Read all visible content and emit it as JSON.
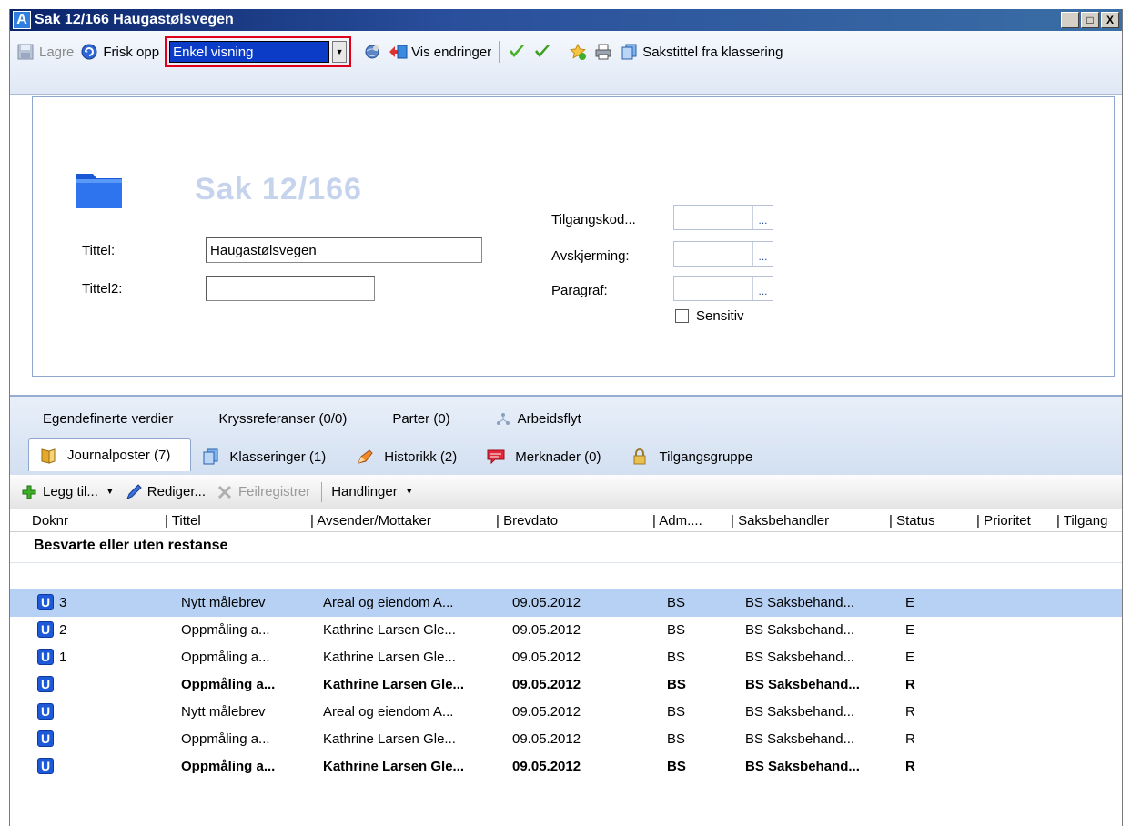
{
  "window": {
    "title": "Sak 12/166 Haugastølsvegen",
    "app_icon_letter": "A",
    "controls": [
      "_",
      "□",
      "X"
    ]
  },
  "toolbar": {
    "save_label": "Lagre",
    "refresh_label": "Frisk opp",
    "view_mode_value": "Enkel visning",
    "show_changes_label": "Vis endringer",
    "title_from_class_label": "Sakstittel fra klassering"
  },
  "case": {
    "heading": "Sak 12/166",
    "title_label": "Tittel:",
    "title_value": "Haugastølsvegen",
    "title2_label": "Tittel2:",
    "title2_value": "",
    "access_code_label": "Tilgangskod...",
    "screening_label": "Avskjerming:",
    "paragraph_label": "Paragraf:",
    "lookup_button": "...",
    "sensitive_label": "Sensitiv"
  },
  "tabs_row1": [
    "Egendefinerte verdier",
    "Kryssreferanser (0/0)",
    "Parter (0)",
    "Arbeidsflyt"
  ],
  "tabs_row2": [
    "Journalposter (7)",
    "Klasseringer (1)",
    "Historikk (2)",
    "Merknader (0)",
    "Tilgangsgruppe"
  ],
  "grid_toolbar": {
    "add_label": "Legg til...",
    "edit_label": "Rediger...",
    "misregister_label": "Feilregistrer",
    "actions_label": "Handlinger"
  },
  "columns": [
    "Doknr",
    "| Tittel",
    "| Avsender/Mottaker",
    "| Brevdato",
    "| Adm....",
    "| Saksbehandler",
    "| Status",
    "| Prioritet",
    "| Tilgang"
  ],
  "group_label": "Besvarte eller uten restanse",
  "rows": [
    {
      "doknr": "3",
      "tittel": "Nytt målebrev",
      "avsender": "Areal og eiendom A...",
      "brevdato": "09.05.2012",
      "adm": "BS",
      "saksbehandler": "BS Saksbehand...",
      "status": "E"
    },
    {
      "doknr": "2",
      "tittel": "Oppmåling a...",
      "avsender": "Kathrine Larsen Gle...",
      "brevdato": "09.05.2012",
      "adm": "BS",
      "saksbehandler": "BS Saksbehand...",
      "status": "E"
    },
    {
      "doknr": "1",
      "tittel": "Oppmåling a...",
      "avsender": "Kathrine Larsen Gle...",
      "brevdato": "09.05.2012",
      "adm": "BS",
      "saksbehandler": "BS Saksbehand...",
      "status": "E"
    },
    {
      "doknr": "",
      "tittel": "Oppmåling a...",
      "avsender": "Kathrine Larsen Gle...",
      "brevdato": "09.05.2012",
      "adm": "BS",
      "saksbehandler": "BS Saksbehand...",
      "status": "R"
    },
    {
      "doknr": "",
      "tittel": "Nytt målebrev",
      "avsender": "Areal og eiendom A...",
      "brevdato": "09.05.2012",
      "adm": "BS",
      "saksbehandler": "BS Saksbehand...",
      "status": "R"
    },
    {
      "doknr": "",
      "tittel": "Oppmåling a...",
      "avsender": "Kathrine Larsen Gle...",
      "brevdato": "09.05.2012",
      "adm": "BS",
      "saksbehandler": "BS Saksbehand...",
      "status": "R"
    },
    {
      "doknr": "",
      "tittel": "Oppmåling a...",
      "avsender": "Kathrine Larsen Gle...",
      "brevdato": "09.05.2012",
      "adm": "BS",
      "saksbehandler": "BS Saksbehand...",
      "status": "R"
    }
  ],
  "row_badge": "U"
}
